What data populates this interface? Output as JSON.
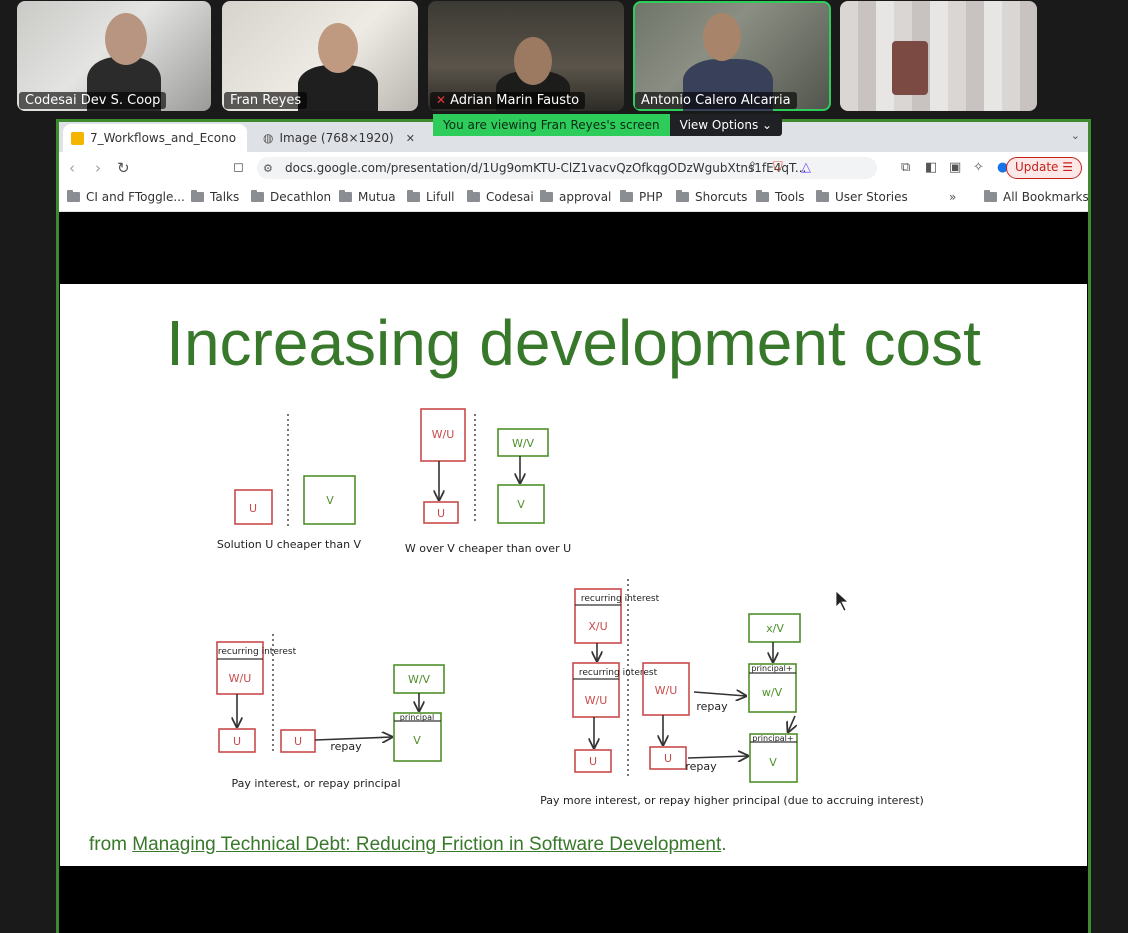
{
  "participants": [
    {
      "name": "Codesai Dev S. Coop",
      "muted": false,
      "active": false
    },
    {
      "name": "Fran Reyes",
      "muted": false,
      "active": false
    },
    {
      "name": "Adrian Marin Fausto",
      "muted": true,
      "active": false
    },
    {
      "name": "Antonio Calero Alcarria",
      "muted": false,
      "active": true
    },
    {
      "name": "",
      "muted": false,
      "active": false
    }
  ],
  "share_banner": {
    "text": "You are viewing Fran Reyes's screen",
    "options_label": "View Options ⌄"
  },
  "browser": {
    "tabs": [
      {
        "label": "7_Workflows_and_Econo",
        "active": true
      },
      {
        "label": "Image (768×1920)",
        "active": false
      }
    ],
    "url": "docs.google.com/presentation/d/1Ug9omKTU-ClZ1vacvQzOfkqgODzWgubXtns1fE4qT...",
    "update_label": "Update ☰",
    "bookmarks": [
      "CI and FToggle...",
      "Talks",
      "Decathlon",
      "Mutua",
      "Lifull",
      "Codesai",
      "approval",
      "PHP",
      "Shorcuts",
      "Tools",
      "User Stories"
    ],
    "more_bookmarks": "»",
    "all_bookmarks": "All Bookmarks"
  },
  "slide": {
    "title": "Increasing development cost",
    "diagram": {
      "box_labels": {
        "u": "U",
        "v": "V",
        "w_u": "W/U",
        "w_v": "W/V",
        "w_v_lower": "w/V",
        "x_u": "X/U",
        "x_v": "x/V"
      },
      "recurring_interest": "recurring interest",
      "principal": "principal",
      "principal_plus": "principal+",
      "repay": "repay",
      "captions": [
        "Solution U cheaper than V",
        "W over V cheaper than over U",
        "Pay interest, or repay principal",
        "Pay more interest, or repay higher principal (due to accruing interest)"
      ]
    },
    "footnote_prefix": "from ",
    "footnote_link": "Managing Technical Debt: Reducing Friction in Software Development",
    "footnote_suffix": "."
  },
  "colors": {
    "accent_green": "#2ecc5a",
    "slide_green": "#38782b",
    "diagram_red": "#c84b4b",
    "diagram_green": "#4f8f2a"
  }
}
